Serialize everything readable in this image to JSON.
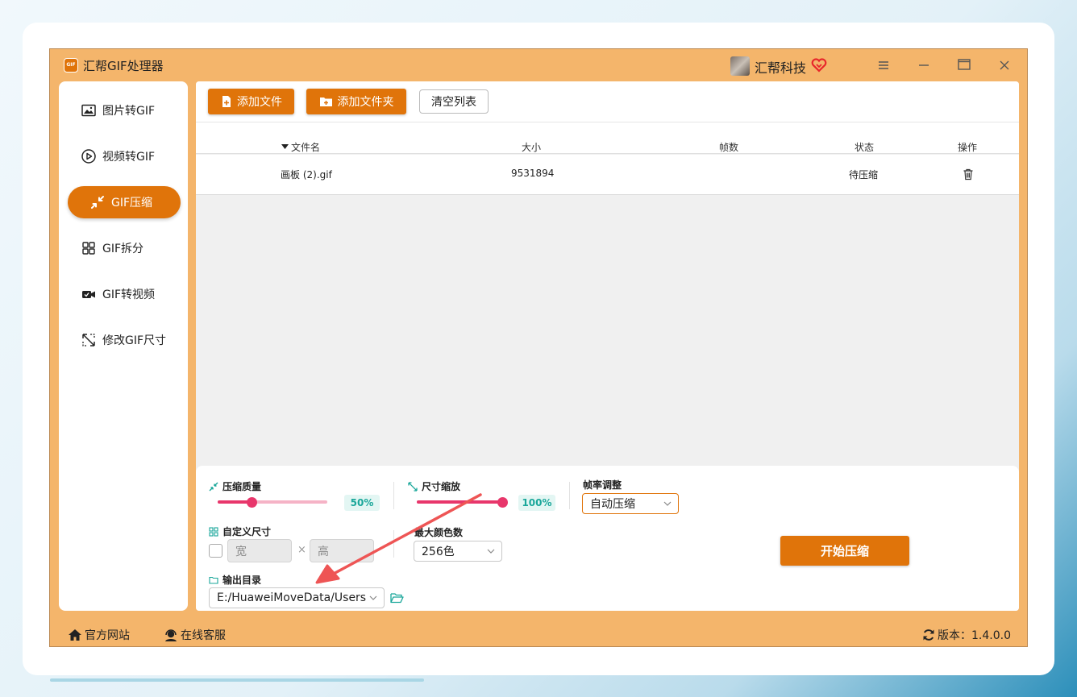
{
  "app": {
    "title": "汇帮GIF处理器",
    "logo_text": "GIF",
    "brand": "汇帮科技"
  },
  "sidebar": {
    "items": [
      {
        "label": "图片转GIF",
        "icon": "image-icon",
        "active": false
      },
      {
        "label": "视频转GIF",
        "icon": "play-circle-icon",
        "active": false
      },
      {
        "label": "GIF压缩",
        "icon": "compress-icon",
        "active": true
      },
      {
        "label": "GIF拆分",
        "icon": "split-icon",
        "active": false
      },
      {
        "label": "GIF转视频",
        "icon": "video-camera-icon",
        "active": false
      },
      {
        "label": "修改GIF尺寸",
        "icon": "resize-icon",
        "active": false
      }
    ]
  },
  "toolbar": {
    "add_file": "添加文件",
    "add_folder": "添加文件夹",
    "clear_list": "清空列表"
  },
  "table": {
    "columns": [
      "文件名",
      "大小",
      "帧数",
      "状态",
      "操作"
    ],
    "rows": [
      {
        "name": "画板 (2).gif",
        "size": "9531894",
        "frames": "",
        "status": "待压缩"
      }
    ]
  },
  "settings": {
    "quality": {
      "label": "压缩质量",
      "value": "50%",
      "fraction": 0.5
    },
    "scale": {
      "label": "尺寸缩放",
      "value": "100%",
      "fraction": 1.0
    },
    "framerate": {
      "label": "帧率调整",
      "value": "自动压缩"
    },
    "custom_size": {
      "label": "自定义尺寸",
      "width_placeholder": "宽",
      "separator": "×",
      "height_placeholder": "高",
      "checked": false
    },
    "max_colors": {
      "label": "最大颜色数",
      "value": "256色"
    },
    "output": {
      "label": "输出目录",
      "path": "E:/HuaweiMoveData/Users"
    },
    "start_button": "开始压缩"
  },
  "footer": {
    "website": "官方网站",
    "support": "在线客服",
    "version": "版本：1.4.0.0"
  },
  "colors": {
    "frame": "#f4b56b",
    "accent": "#e0740a",
    "slider": "#e8366b",
    "badge_text": "#1aa79a",
    "annotation_arrow": "#ee5555"
  }
}
